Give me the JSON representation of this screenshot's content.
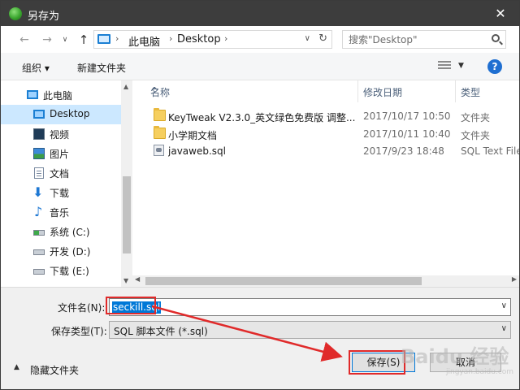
{
  "window": {
    "title": "另存为",
    "close_glyph": "✕"
  },
  "nav": {
    "back_glyph": "←",
    "forward_glyph": "→",
    "recent_glyph": "∨",
    "up_glyph": "↑",
    "breadcrumb": [
      "此电脑",
      "Desktop"
    ],
    "crumb_sep": "›",
    "dropdown_glyph": "∨",
    "refresh_glyph": "↻",
    "search_placeholder": "搜索\"Desktop\""
  },
  "toolbar": {
    "organize_label": "组织 ▾",
    "new_folder_label": "新建文件夹",
    "view_dd_glyph": "▼",
    "help_glyph": "?"
  },
  "sidebar": {
    "items": [
      {
        "label": "此电脑",
        "icon": "monitor-icon"
      },
      {
        "label": "Desktop",
        "icon": "monitor-icon"
      },
      {
        "label": "视频",
        "icon": "video-icon"
      },
      {
        "label": "图片",
        "icon": "picture-icon"
      },
      {
        "label": "文档",
        "icon": "document-icon"
      },
      {
        "label": "下载",
        "icon": "download-icon"
      },
      {
        "label": "音乐",
        "icon": "music-icon"
      },
      {
        "label": "系统 (C:)",
        "icon": "system-drive-icon"
      },
      {
        "label": "开发 (D:)",
        "icon": "drive-icon"
      },
      {
        "label": "下载 (E:)",
        "icon": "drive-icon"
      }
    ],
    "selected_index": 1
  },
  "filelist": {
    "columns": [
      "名称",
      "修改日期",
      "类型"
    ],
    "sort_glyph": "^",
    "rows": [
      {
        "name": "KeyTweak V2.3.0_英文绿色免费版 调整...",
        "date": "2017/10/17 10:50",
        "type": "文件夹",
        "icon": "folder-icon"
      },
      {
        "name": "小学期文档",
        "date": "2017/10/11 10:40",
        "type": "文件夹",
        "icon": "folder-icon"
      },
      {
        "name": "javaweb.sql",
        "date": "2017/9/23 18:48",
        "type": "SQL Text File",
        "icon": "sql-file-icon"
      }
    ]
  },
  "form": {
    "filename_label": "文件名(N):",
    "filename_value": "seckill.sql",
    "filetype_label": "保存类型(T):",
    "filetype_value": "SQL 脚本文件 (*.sql)",
    "hide_folders_label": "隐藏文件夹",
    "save_label": "保存(S)",
    "cancel_label": "取消"
  },
  "annotation_color": "#e02a2a",
  "accent_color": "#0078d7",
  "watermark": {
    "brand": "Baidu 经验",
    "sub": "jingyan.baidu.com"
  }
}
